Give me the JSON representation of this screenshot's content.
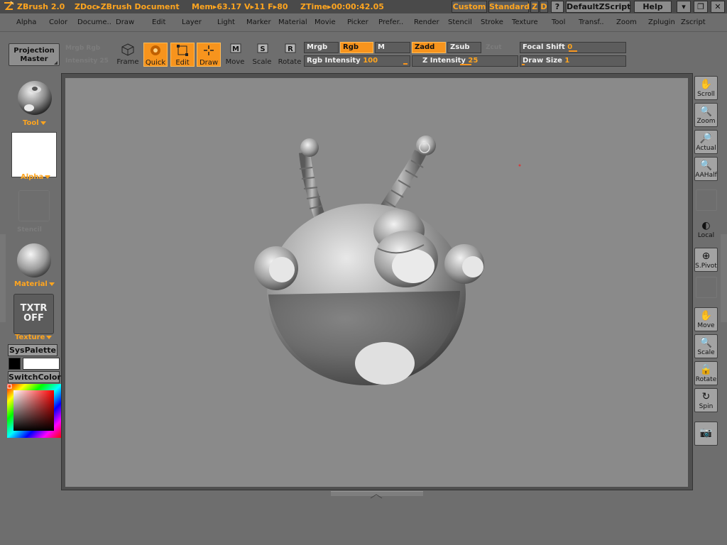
{
  "titlebar": {
    "app": "ZBrush 2.0",
    "doc": "ZDoc▸ZBrush Document",
    "stats": "Mem▸63.17  V▸11  F▸80",
    "ztime": "ZTime▸00:00:42.05",
    "custom": "Custom",
    "standard": "Standard",
    "z": "Z",
    "d": "D",
    "q": "?",
    "script": "DefaultZScript",
    "help": "Help",
    "minimize": "▾",
    "restore": "❐",
    "close": "✕"
  },
  "menu": [
    "Alpha",
    "Color",
    "Docume..",
    "Draw",
    "Edit",
    "Layer",
    "Light",
    "Marker",
    "Material",
    "Movie",
    "Picker",
    "Prefer..",
    "Render",
    "Stencil",
    "Stroke",
    "Texture",
    "Tool",
    "Transf..",
    "Zoom",
    "Zplugin",
    "Zscript"
  ],
  "toolbar": {
    "projection_master": [
      "Projection",
      "Master"
    ],
    "ghost_a": "Mrgb  Rgb",
    "ghost_b": "Intensity 25",
    "frame": "Frame",
    "quick": "Quick",
    "edit": "Edit",
    "draw": "Draw",
    "move": "Move",
    "scale": "Scale",
    "rotate": "Rotate",
    "mrgb": "Mrgb",
    "rgb": "Rgb",
    "m": "M",
    "zadd": "Zadd",
    "zsub": "Zsub",
    "zcut": "Zcut",
    "rgb_intensity_label": "Rgb Intensity",
    "rgb_intensity_value": "100",
    "z_intensity_label": "Z Intensity",
    "z_intensity_value": "25",
    "focal_shift_label": "Focal Shift",
    "focal_shift_value": "0",
    "draw_size_label": "Draw Size",
    "draw_size_value": "1"
  },
  "leftshelf": {
    "tool": "Tool",
    "alpha": "Alpha",
    "stencil": "Stencil",
    "material": "Material",
    "texture_line1": "TXTR",
    "texture_line2": "OFF",
    "texture": "Texture",
    "syspalette": "SysPalette",
    "switchcolor": "SwitchColor"
  },
  "rightshelf": [
    "Scroll",
    "Zoom",
    "Actual",
    "AAHalf",
    "Local",
    "S.Pivot",
    "Move",
    "Scale",
    "Rotate",
    "Spin"
  ],
  "colors": {
    "accent": "#f7941d",
    "accent_text": "#ffa51f",
    "canvas": "#8a8a8a",
    "ui_bg": "#6e6e6e"
  }
}
